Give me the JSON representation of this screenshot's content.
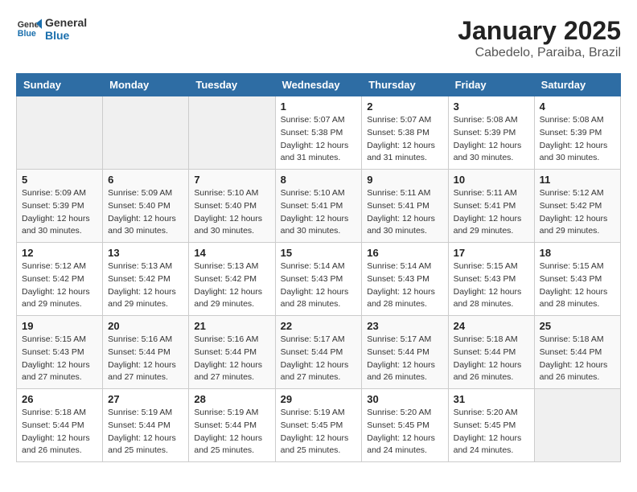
{
  "brand": {
    "name_general": "General",
    "name_blue": "Blue"
  },
  "title": "January 2025",
  "subtitle": "Cabedelo, Paraiba, Brazil",
  "days_of_week": [
    "Sunday",
    "Monday",
    "Tuesday",
    "Wednesday",
    "Thursday",
    "Friday",
    "Saturday"
  ],
  "weeks": [
    [
      {
        "day": "",
        "info": ""
      },
      {
        "day": "",
        "info": ""
      },
      {
        "day": "",
        "info": ""
      },
      {
        "day": "1",
        "info": "Sunrise: 5:07 AM\nSunset: 5:38 PM\nDaylight: 12 hours\nand 31 minutes."
      },
      {
        "day": "2",
        "info": "Sunrise: 5:07 AM\nSunset: 5:38 PM\nDaylight: 12 hours\nand 31 minutes."
      },
      {
        "day": "3",
        "info": "Sunrise: 5:08 AM\nSunset: 5:39 PM\nDaylight: 12 hours\nand 30 minutes."
      },
      {
        "day": "4",
        "info": "Sunrise: 5:08 AM\nSunset: 5:39 PM\nDaylight: 12 hours\nand 30 minutes."
      }
    ],
    [
      {
        "day": "5",
        "info": "Sunrise: 5:09 AM\nSunset: 5:39 PM\nDaylight: 12 hours\nand 30 minutes."
      },
      {
        "day": "6",
        "info": "Sunrise: 5:09 AM\nSunset: 5:40 PM\nDaylight: 12 hours\nand 30 minutes."
      },
      {
        "day": "7",
        "info": "Sunrise: 5:10 AM\nSunset: 5:40 PM\nDaylight: 12 hours\nand 30 minutes."
      },
      {
        "day": "8",
        "info": "Sunrise: 5:10 AM\nSunset: 5:41 PM\nDaylight: 12 hours\nand 30 minutes."
      },
      {
        "day": "9",
        "info": "Sunrise: 5:11 AM\nSunset: 5:41 PM\nDaylight: 12 hours\nand 30 minutes."
      },
      {
        "day": "10",
        "info": "Sunrise: 5:11 AM\nSunset: 5:41 PM\nDaylight: 12 hours\nand 29 minutes."
      },
      {
        "day": "11",
        "info": "Sunrise: 5:12 AM\nSunset: 5:42 PM\nDaylight: 12 hours\nand 29 minutes."
      }
    ],
    [
      {
        "day": "12",
        "info": "Sunrise: 5:12 AM\nSunset: 5:42 PM\nDaylight: 12 hours\nand 29 minutes."
      },
      {
        "day": "13",
        "info": "Sunrise: 5:13 AM\nSunset: 5:42 PM\nDaylight: 12 hours\nand 29 minutes."
      },
      {
        "day": "14",
        "info": "Sunrise: 5:13 AM\nSunset: 5:42 PM\nDaylight: 12 hours\nand 29 minutes."
      },
      {
        "day": "15",
        "info": "Sunrise: 5:14 AM\nSunset: 5:43 PM\nDaylight: 12 hours\nand 28 minutes."
      },
      {
        "day": "16",
        "info": "Sunrise: 5:14 AM\nSunset: 5:43 PM\nDaylight: 12 hours\nand 28 minutes."
      },
      {
        "day": "17",
        "info": "Sunrise: 5:15 AM\nSunset: 5:43 PM\nDaylight: 12 hours\nand 28 minutes."
      },
      {
        "day": "18",
        "info": "Sunrise: 5:15 AM\nSunset: 5:43 PM\nDaylight: 12 hours\nand 28 minutes."
      }
    ],
    [
      {
        "day": "19",
        "info": "Sunrise: 5:15 AM\nSunset: 5:43 PM\nDaylight: 12 hours\nand 27 minutes."
      },
      {
        "day": "20",
        "info": "Sunrise: 5:16 AM\nSunset: 5:44 PM\nDaylight: 12 hours\nand 27 minutes."
      },
      {
        "day": "21",
        "info": "Sunrise: 5:16 AM\nSunset: 5:44 PM\nDaylight: 12 hours\nand 27 minutes."
      },
      {
        "day": "22",
        "info": "Sunrise: 5:17 AM\nSunset: 5:44 PM\nDaylight: 12 hours\nand 27 minutes."
      },
      {
        "day": "23",
        "info": "Sunrise: 5:17 AM\nSunset: 5:44 PM\nDaylight: 12 hours\nand 26 minutes."
      },
      {
        "day": "24",
        "info": "Sunrise: 5:18 AM\nSunset: 5:44 PM\nDaylight: 12 hours\nand 26 minutes."
      },
      {
        "day": "25",
        "info": "Sunrise: 5:18 AM\nSunset: 5:44 PM\nDaylight: 12 hours\nand 26 minutes."
      }
    ],
    [
      {
        "day": "26",
        "info": "Sunrise: 5:18 AM\nSunset: 5:44 PM\nDaylight: 12 hours\nand 26 minutes."
      },
      {
        "day": "27",
        "info": "Sunrise: 5:19 AM\nSunset: 5:44 PM\nDaylight: 12 hours\nand 25 minutes."
      },
      {
        "day": "28",
        "info": "Sunrise: 5:19 AM\nSunset: 5:44 PM\nDaylight: 12 hours\nand 25 minutes."
      },
      {
        "day": "29",
        "info": "Sunrise: 5:19 AM\nSunset: 5:45 PM\nDaylight: 12 hours\nand 25 minutes."
      },
      {
        "day": "30",
        "info": "Sunrise: 5:20 AM\nSunset: 5:45 PM\nDaylight: 12 hours\nand 24 minutes."
      },
      {
        "day": "31",
        "info": "Sunrise: 5:20 AM\nSunset: 5:45 PM\nDaylight: 12 hours\nand 24 minutes."
      },
      {
        "day": "",
        "info": ""
      }
    ]
  ]
}
